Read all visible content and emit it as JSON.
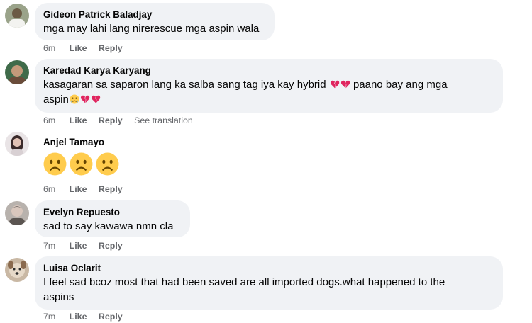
{
  "comments": [
    {
      "author": "Gideon Patrick Baladjay",
      "text": "mga may lahi lang nirerescue mga aspin wala",
      "time": "6m",
      "like_label": "Like",
      "reply_label": "Reply"
    },
    {
      "author": "Karedad Karya Karyang",
      "text_line1": "kasagaran sa saparon lang ka salba sang tag iya kay hybrid",
      "text_line1_tail": "paano bay ang mga",
      "text_line2": "aspin",
      "time": "6m",
      "like_label": "Like",
      "reply_label": "Reply",
      "translate_label": "See translation",
      "emojis": [
        "broken-heart-icon",
        "crying-face-icon"
      ]
    },
    {
      "author": "Anjel Tamayo",
      "time": "6m",
      "like_label": "Like",
      "reply_label": "Reply",
      "emojis": [
        "sad-face-icon",
        "sad-face-icon",
        "sad-face-icon"
      ]
    },
    {
      "author": "Evelyn Repuesto",
      "text": "sad to say kawawa nmn cla",
      "time": "7m",
      "like_label": "Like",
      "reply_label": "Reply"
    },
    {
      "author": "Luisa Oclarit",
      "text_line1": "I feel sad bcoz most that had been saved are all imported dogs.what happened to the",
      "text_line2": "aspins",
      "time": "7m",
      "like_label": "Like",
      "reply_label": "Reply"
    }
  ],
  "colors": {
    "bubble": "#f0f2f5",
    "secondary_text": "#65676b",
    "emoji_red": "#e0245e",
    "emoji_yellow": "#ffcc4d"
  }
}
